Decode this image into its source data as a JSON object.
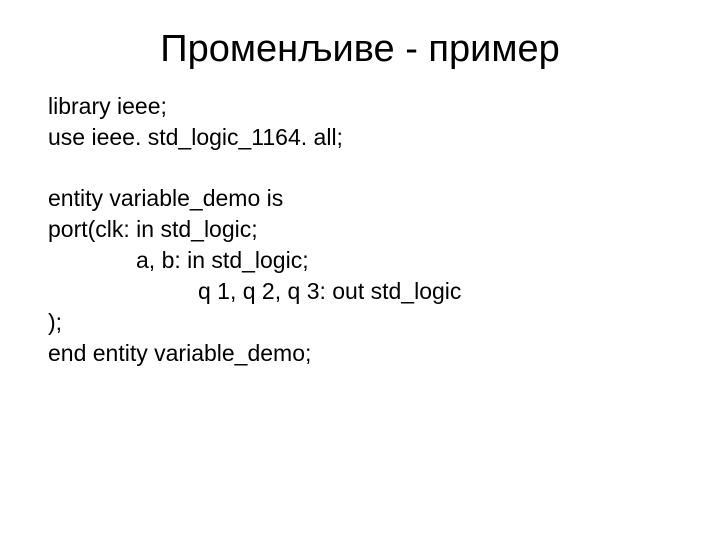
{
  "title": "Променљиве - пример",
  "lines": {
    "l1": "library ieee;",
    "l2": "use ieee. std_logic_1164. all;",
    "l3": "entity variable_demo is",
    "l4": "port(clk: in std_logic;",
    "l5": "a, b: in std_logic;",
    "l6": "q 1, q 2, q 3: out std_logic",
    "l7": ");",
    "l8": "end entity variable_demo;"
  }
}
